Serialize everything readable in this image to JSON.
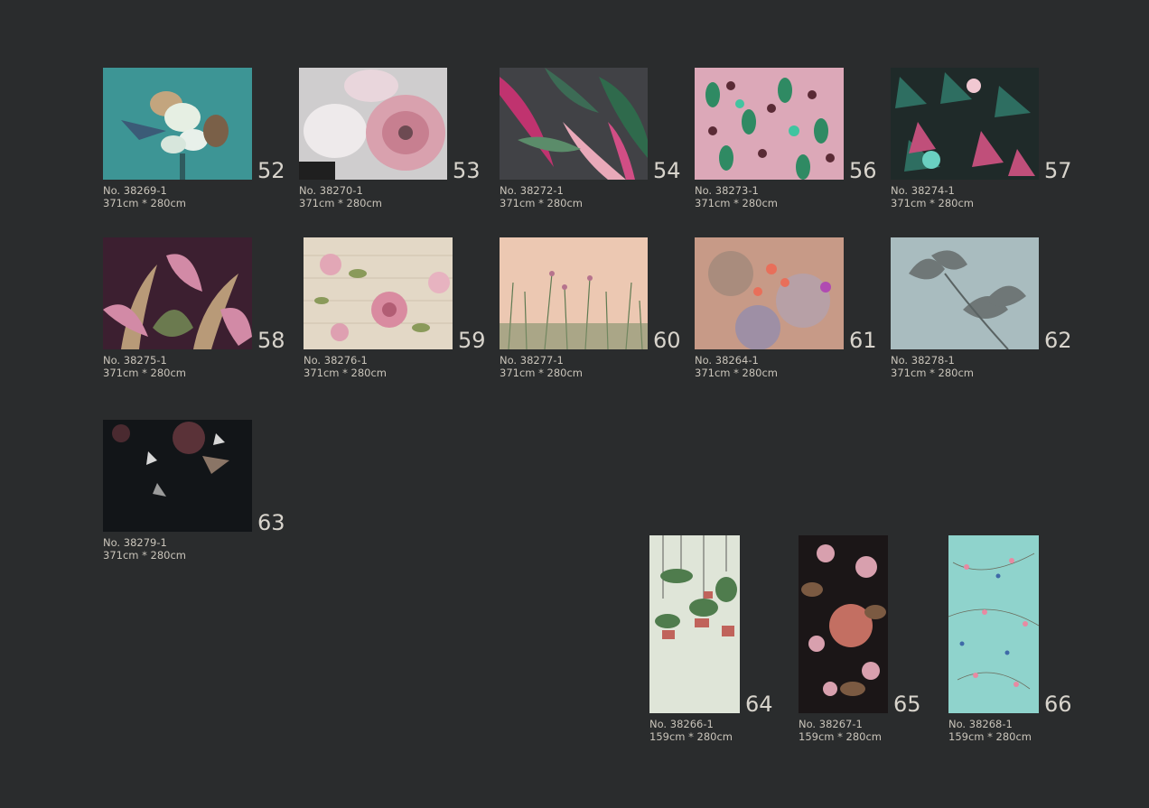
{
  "catalog": {
    "items": [
      {
        "page": "52",
        "code": "No. 38269-1",
        "size": "371cm * 280cm"
      },
      {
        "page": "53",
        "code": "No. 38270-1",
        "size": "371cm * 280cm"
      },
      {
        "page": "54",
        "code": "No. 38272-1",
        "size": "371cm * 280cm"
      },
      {
        "page": "56",
        "code": "No. 38273-1",
        "size": "371cm * 280cm"
      },
      {
        "page": "57",
        "code": "No. 38274-1",
        "size": "371cm * 280cm"
      },
      {
        "page": "58",
        "code": "No. 38275-1",
        "size": "371cm * 280cm"
      },
      {
        "page": "59",
        "code": "No. 38276-1",
        "size": "371cm * 280cm"
      },
      {
        "page": "60",
        "code": "No. 38277-1",
        "size": "371cm * 280cm"
      },
      {
        "page": "61",
        "code": "No. 38264-1",
        "size": "371cm * 280cm"
      },
      {
        "page": "62",
        "code": "No. 38278-1",
        "size": "371cm * 280cm"
      },
      {
        "page": "63",
        "code": "No. 38279-1",
        "size": "371cm * 280cm"
      },
      {
        "page": "64",
        "code": "No. 38266-1",
        "size": "159cm * 280cm"
      },
      {
        "page": "65",
        "code": "No. 38267-1",
        "size": "159cm * 280cm"
      },
      {
        "page": "66",
        "code": "No. 38268-1",
        "size": "159cm * 280cm"
      }
    ]
  },
  "colors": {
    "background": "#2a2c2d",
    "page_number": "#d8d4cc",
    "caption": "#c9c4ba"
  }
}
